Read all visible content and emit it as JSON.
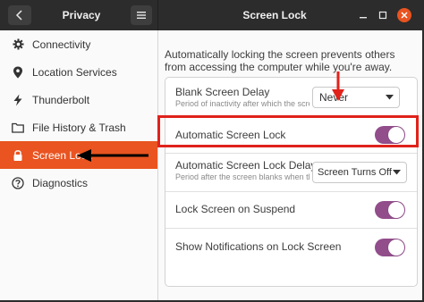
{
  "titlebar": {
    "sidebar_title": "Privacy",
    "main_title": "Screen Lock",
    "back_icon": "chevron-left-icon",
    "menu_icon": "hamburger-menu-icon",
    "window_controls": [
      "minimize-icon",
      "maximize-icon",
      "close-icon"
    ]
  },
  "sidebar": {
    "items": [
      {
        "label": "Connectivity",
        "icon": "gear-icon"
      },
      {
        "label": "Location Services",
        "icon": "location-pin-icon"
      },
      {
        "label": "Thunderbolt",
        "icon": "lightning-icon"
      },
      {
        "label": "File History & Trash",
        "icon": "folder-icon"
      },
      {
        "label": "Screen Lock",
        "icon": "lock-icon",
        "active": true
      },
      {
        "label": "Diagnostics",
        "icon": "question-icon"
      }
    ]
  },
  "main": {
    "description": "Automatically locking the screen prevents others from accessing the computer while you're away.",
    "rows": [
      {
        "label": "Blank Screen Delay",
        "subtitle": "Period of inactivity after which the screen will go blank.",
        "control": "dropdown",
        "value": "Never"
      },
      {
        "label": "Automatic Screen Lock",
        "control": "toggle",
        "checked": true
      },
      {
        "label": "Automatic Screen Lock Delay",
        "subtitle": "Period after the screen blanks when the screen is automatically locked.",
        "control": "dropdown",
        "value": "Screen Turns Off"
      },
      {
        "label": "Lock Screen on Suspend",
        "control": "toggle",
        "checked": true
      },
      {
        "label": "Show Notifications on Lock Screen",
        "control": "toggle",
        "checked": true
      }
    ]
  },
  "colors": {
    "accent": "#e95420",
    "toggle_on": "#924d8b",
    "annotation_red": "#e0221b",
    "titlebar": "#2c2c2c"
  }
}
